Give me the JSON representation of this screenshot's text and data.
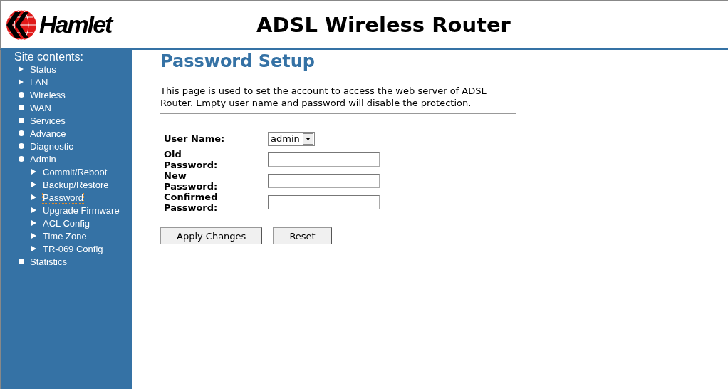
{
  "header": {
    "logo": "Hamlet",
    "title": "ADSL Wireless Router"
  },
  "sidebar": {
    "heading": "Site contents:",
    "items": [
      {
        "label": "Status",
        "kind": "arrow",
        "selected": false
      },
      {
        "label": "LAN",
        "kind": "arrow",
        "selected": false
      },
      {
        "label": "Wireless",
        "kind": "bullet",
        "selected": false
      },
      {
        "label": "WAN",
        "kind": "bullet",
        "selected": false
      },
      {
        "label": "Services",
        "kind": "bullet",
        "selected": false
      },
      {
        "label": "Advance",
        "kind": "bullet",
        "selected": false
      },
      {
        "label": "Diagnostic",
        "kind": "bullet",
        "selected": false
      },
      {
        "label": "Admin",
        "kind": "bullet",
        "selected": false,
        "children": [
          {
            "label": "Commit/Reboot",
            "kind": "arrow",
            "selected": false
          },
          {
            "label": "Backup/Restore",
            "kind": "arrow",
            "selected": false
          },
          {
            "label": "Password",
            "kind": "arrow",
            "selected": true
          },
          {
            "label": "Upgrade Firmware",
            "kind": "arrow",
            "selected": false
          },
          {
            "label": "ACL Config",
            "kind": "arrow",
            "selected": false
          },
          {
            "label": "Time Zone",
            "kind": "arrow",
            "selected": false
          },
          {
            "label": "TR-069 Config",
            "kind": "arrow",
            "selected": false
          }
        ]
      },
      {
        "label": "Statistics",
        "kind": "bullet",
        "selected": false
      }
    ]
  },
  "page": {
    "title": "Password Setup",
    "description": "This page is used to set the account to access the web server of ADSL Router. Empty user name and password will disable the protection.",
    "fields": [
      {
        "label": "User Name:",
        "kind": "select",
        "value": "admin"
      },
      {
        "label": "Old Password:",
        "kind": "password"
      },
      {
        "label": "New Password:",
        "kind": "password"
      },
      {
        "label": "Confirmed Password:",
        "kind": "password"
      }
    ],
    "buttons": [
      "Apply Changes",
      "Reset"
    ]
  }
}
